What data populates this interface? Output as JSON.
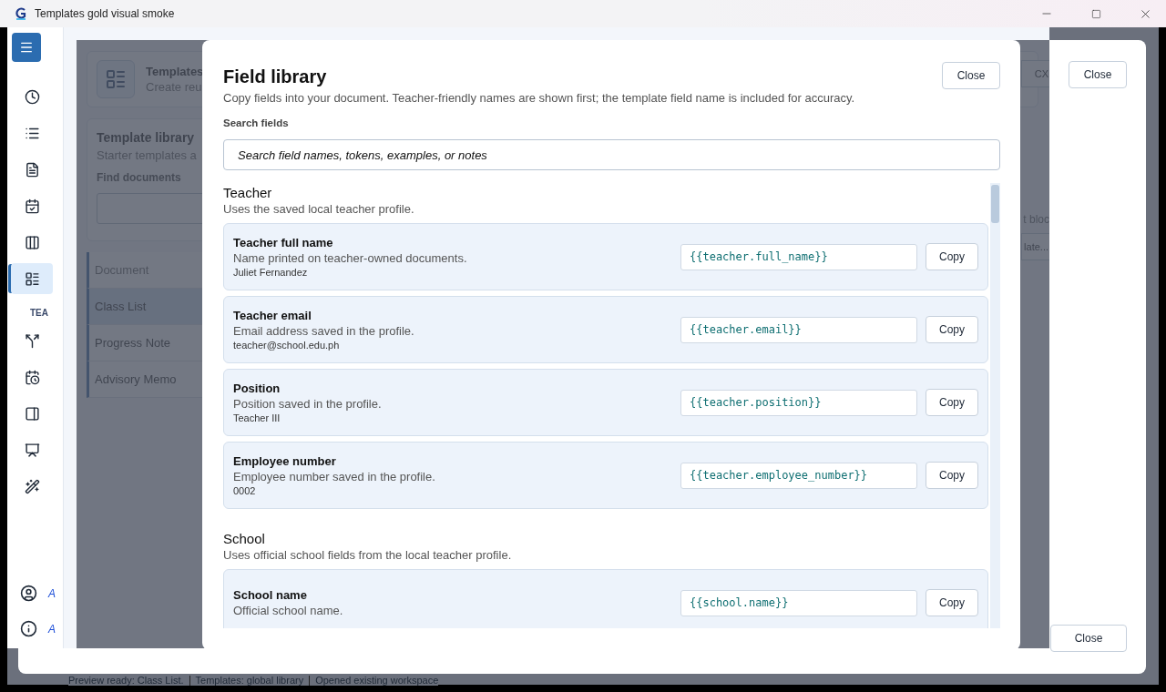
{
  "window": {
    "title": "Templates gold visual smoke"
  },
  "sidebar": {
    "items": [
      {
        "kind": "nav",
        "selected": false
      },
      {
        "kind": "nav",
        "selected": false
      },
      {
        "kind": "nav",
        "selected": false
      },
      {
        "kind": "nav",
        "selected": false
      },
      {
        "kind": "nav",
        "selected": false
      },
      {
        "kind": "nav",
        "selected": true
      },
      {
        "kind": "heading",
        "text": "TEA"
      },
      {
        "kind": "nav",
        "selected": false
      },
      {
        "kind": "nav",
        "selected": false
      },
      {
        "kind": "nav",
        "selected": false
      },
      {
        "kind": "nav",
        "selected": false
      },
      {
        "kind": "nav",
        "selected": false
      }
    ],
    "footer": [
      {
        "label": "A"
      },
      {
        "label": "A"
      }
    ]
  },
  "background": {
    "header": {
      "title": "Templates",
      "subtitle": "Create reu"
    },
    "library": {
      "title": "Template library",
      "subtitle": "Starter templates a",
      "search_label": "Find documents"
    },
    "documents": {
      "heading": "Document",
      "items": [
        {
          "name": "Class List",
          "selected": true
        },
        {
          "name": "Progress Note",
          "selected": false
        },
        {
          "name": "Advisory Memo",
          "selected": false
        }
      ]
    },
    "right": {
      "export_button": "CX",
      "text": "t bloc",
      "action_button": "late..."
    }
  },
  "outer_dialog": {
    "top_button": "Close",
    "bottom_button": "Close"
  },
  "status_bar": [
    "Preview ready: Class List.",
    "Templates: global library",
    "Opened existing workspace"
  ],
  "field_library": {
    "title": "Field library",
    "subtitle": "Copy fields into your document. Teacher-friendly names are shown first; the template field name is included for accuracy.",
    "close": "Close",
    "search_label": "Search fields",
    "search": {
      "placeholder": "Search field names, tokens, examples, or notes"
    },
    "groups": [
      {
        "title": "Teacher",
        "description": "Uses the saved local teacher profile.",
        "fields": [
          {
            "name": "Teacher full name",
            "description": "Name printed on teacher-owned documents.",
            "example": "Juliet Fernandez",
            "token": "{{teacher.full_name}}",
            "button": "Copy"
          },
          {
            "name": "Teacher email",
            "description": "Email address saved in the profile.",
            "example": "teacher@school.edu.ph",
            "token": "{{teacher.email}}",
            "button": "Copy"
          },
          {
            "name": "Position",
            "description": "Position saved in the profile.",
            "example": "Teacher III",
            "token": "{{teacher.position}}",
            "button": "Copy"
          },
          {
            "name": "Employee number",
            "description": "Employee number saved in the profile.",
            "example": "0002",
            "token": "{{teacher.employee_number}}",
            "button": "Copy"
          }
        ]
      },
      {
        "title": "School",
        "description": "Uses official school fields from the local teacher profile.",
        "fields": [
          {
            "name": "School name",
            "description": "Official school name.",
            "token": "{{school.name}}",
            "button": "Copy"
          }
        ]
      }
    ]
  }
}
